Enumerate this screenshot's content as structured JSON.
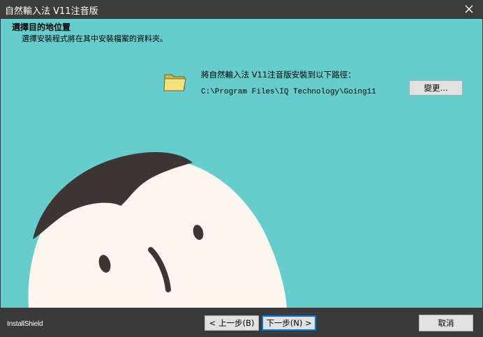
{
  "window": {
    "title": "自然輸入法 V11注音版",
    "close_icon": "close-icon"
  },
  "header": {
    "title": "選擇目的地位置",
    "subtitle": "選擇安裝程式將在其中安裝檔案的資料夾。"
  },
  "destination": {
    "icon": "folder-icon",
    "label": "將自然輸入法 V11注音版安裝到以下路徑：",
    "path": "C:\\Program Files\\IQ Technology\\Going11",
    "change_label": "變更..."
  },
  "footer": {
    "brand": "InstallShield",
    "back_label": "< 上一步(B)",
    "next_label": "下一步(N) >",
    "cancel_label": "取消"
  },
  "colors": {
    "background": "#66cccc",
    "titlebar": "#3c3c3c",
    "footer": "#3a3a3a",
    "face": "#fbf6ef",
    "hair": "#3b3536"
  }
}
